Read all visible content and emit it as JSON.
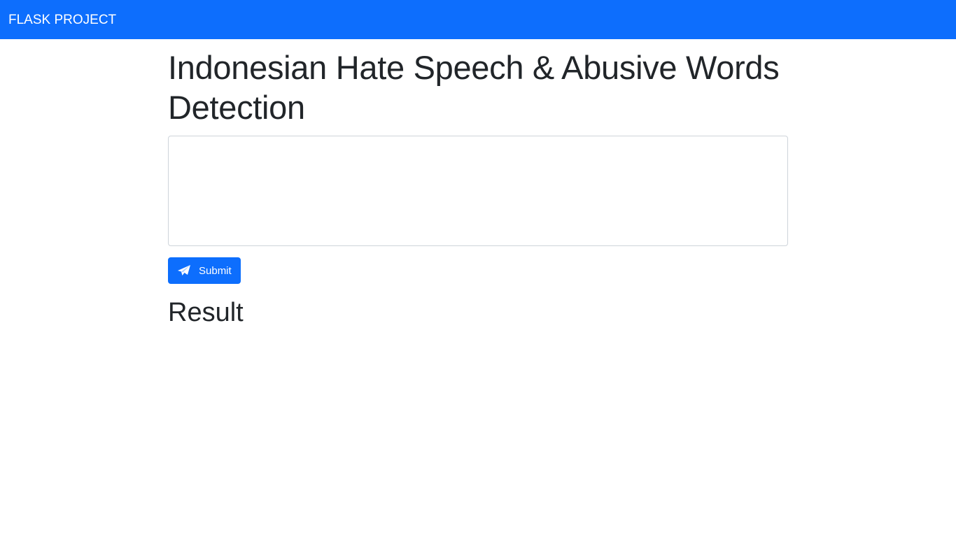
{
  "navbar": {
    "brand": "FLASK PROJECT",
    "color": "#0d6efd"
  },
  "main": {
    "title": "Indonesian Hate Speech & Abusive Words Detection",
    "textarea": {
      "value": "",
      "placeholder": ""
    },
    "submit": {
      "label": "Submit",
      "icon": "paper-plane-icon"
    },
    "result_heading": "Result"
  }
}
